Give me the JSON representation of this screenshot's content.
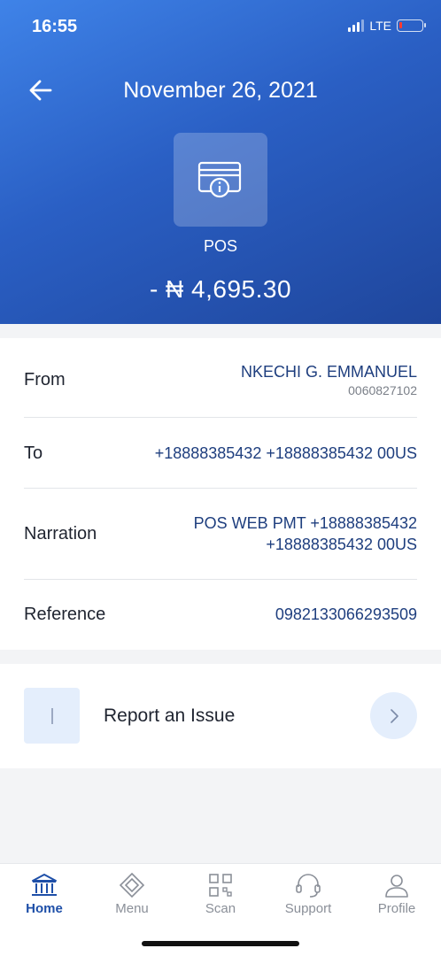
{
  "status_bar": {
    "time": "16:55",
    "network": "LTE"
  },
  "header": {
    "title": "November 26, 2021",
    "transaction_type": "POS",
    "amount": "- ₦ 4,695.30"
  },
  "details": {
    "from": {
      "label": "From",
      "name": "NKECHI G. EMMANUEL",
      "account": "0060827102"
    },
    "to": {
      "label": "To",
      "value": "+18888385432 +18888385432 00US"
    },
    "narration": {
      "label": "Narration",
      "line1": "POS WEB PMT +18888385432",
      "line2": "+18888385432 00US"
    },
    "reference": {
      "label": "Reference",
      "value": "0982133066293509"
    }
  },
  "report": {
    "label": "Report an Issue"
  },
  "tabs": [
    {
      "label": "Home",
      "icon": "bank-icon",
      "active": true
    },
    {
      "label": "Menu",
      "icon": "menu-diamond-icon",
      "active": false
    },
    {
      "label": "Scan",
      "icon": "qr-scan-icon",
      "active": false
    },
    {
      "label": "Support",
      "icon": "headset-icon",
      "active": false
    },
    {
      "label": "Profile",
      "icon": "person-icon",
      "active": false
    }
  ],
  "colors": {
    "header_gradient_start": "#3f83e8",
    "header_gradient_end": "#1f469c",
    "value_text": "#1e3e7e",
    "active_tab": "#1e4fa8",
    "inactive_tab": "#8a8f98"
  }
}
